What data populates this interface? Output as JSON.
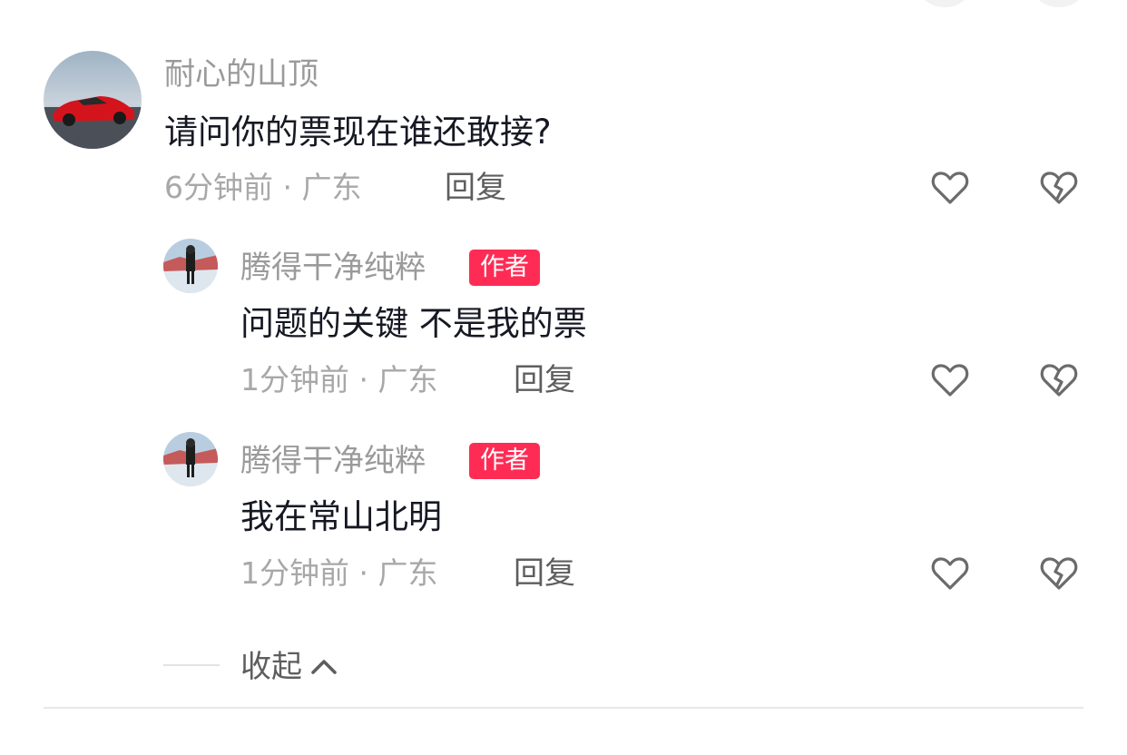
{
  "comments": [
    {
      "username": "耐心的山顶",
      "text": "请问你的票现在谁还敢接?",
      "meta": "6分钟前 · 广东",
      "reply_label": "回复",
      "is_author": false
    },
    {
      "username": "腾得干净纯粹",
      "badge": "作者",
      "text": "问题的关键 不是我的票",
      "meta": "1分钟前 · 广东",
      "reply_label": "回复",
      "is_author": true
    },
    {
      "username": "腾得干净纯粹",
      "badge": "作者",
      "text": "我在常山北明",
      "meta": "1分钟前 · 广东",
      "reply_label": "回复",
      "is_author": true
    }
  ],
  "collapse_label": "收起",
  "icons": {
    "like": "heart-outline-icon",
    "dislike": "broken-heart-icon",
    "collapse": "chevron-up-icon"
  },
  "colors": {
    "author_badge": "#fe2c55",
    "username": "#9a9a9a",
    "comment_text": "#161823",
    "meta": "#a8a8a8",
    "reply": "#5e5e5e",
    "icon": "#6b6b6b"
  }
}
